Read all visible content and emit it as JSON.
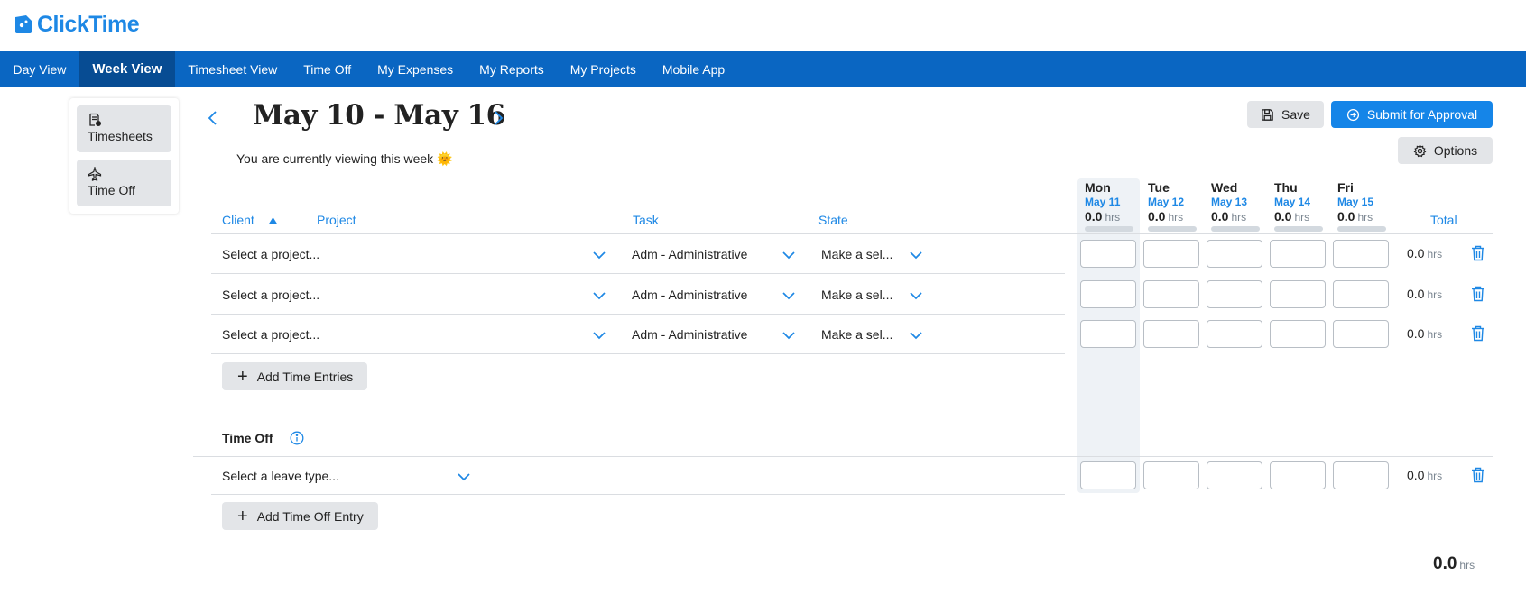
{
  "app": {
    "logo_text": "ClickTime",
    "brand_color": "#0A66C2",
    "accent_color": "#1E88E5"
  },
  "topnav": {
    "items": [
      {
        "label": "Day View",
        "active": false
      },
      {
        "label": "Week View",
        "active": true
      },
      {
        "label": "Timesheet View",
        "active": false
      },
      {
        "label": "Time Off",
        "active": false
      },
      {
        "label": "My Expenses",
        "active": false
      },
      {
        "label": "My Reports",
        "active": false
      },
      {
        "label": "My Projects",
        "active": false
      },
      {
        "label": "Mobile App",
        "active": false
      }
    ]
  },
  "sidebar": {
    "items": [
      {
        "label": "Timesheets",
        "icon": "timesheet-icon"
      },
      {
        "label": "Time Off",
        "icon": "airplane-icon"
      }
    ]
  },
  "header": {
    "week_range": "May 10 - May 16",
    "subtitle": "You are currently viewing this week 🌞",
    "save_label": "Save",
    "submit_label": "Submit for Approval",
    "options_label": "Options"
  },
  "columns": {
    "client": "Client",
    "project": "Project",
    "task": "Task",
    "state": "State",
    "total": "Total"
  },
  "days": [
    {
      "name": "Mon",
      "date": "May 11",
      "hours": "0.0",
      "unit": "hrs",
      "progress": 0
    },
    {
      "name": "Tue",
      "date": "May 12",
      "hours": "0.0",
      "unit": "hrs",
      "progress": 0
    },
    {
      "name": "Wed",
      "date": "May 13",
      "hours": "0.0",
      "unit": "hrs",
      "progress": 0
    },
    {
      "name": "Thu",
      "date": "May 14",
      "hours": "0.0",
      "unit": "hrs",
      "progress": 0
    },
    {
      "name": "Fri",
      "date": "May 15",
      "hours": "0.0",
      "unit": "hrs",
      "progress": 0
    }
  ],
  "time_entries": [
    {
      "project": "Select a project...",
      "task": "Adm - Administrative",
      "state": "Make a sel...",
      "total": "0.0",
      "unit": "hrs",
      "hours": [
        "",
        "",
        "",
        "",
        ""
      ]
    },
    {
      "project": "Select a project...",
      "task": "Adm - Administrative",
      "state": "Make a sel...",
      "total": "0.0",
      "unit": "hrs",
      "hours": [
        "",
        "",
        "",
        "",
        ""
      ]
    },
    {
      "project": "Select a project...",
      "task": "Adm - Administrative",
      "state": "Make a sel...",
      "total": "0.0",
      "unit": "hrs",
      "hours": [
        "",
        "",
        "",
        "",
        ""
      ]
    }
  ],
  "add_time_entries_label": "Add Time Entries",
  "time_off": {
    "title": "Time Off",
    "entries": [
      {
        "leave_type": "Select a leave type...",
        "total": "0.0",
        "unit": "hrs",
        "hours": [
          "",
          "",
          "",
          "",
          ""
        ]
      }
    ],
    "add_label": "Add Time Off Entry"
  },
  "grand_total": {
    "value": "0.0",
    "unit": "hrs"
  }
}
